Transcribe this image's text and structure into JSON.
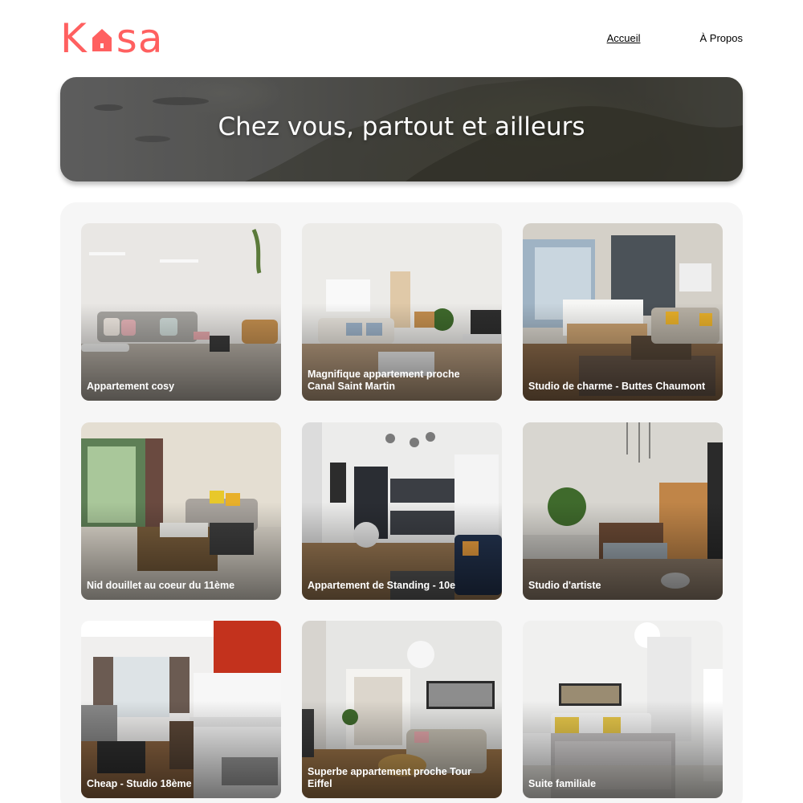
{
  "brand": {
    "logo_text_left": "K",
    "logo_text_right": "sa",
    "logo_icon": "house-icon",
    "accent": "#FF6060"
  },
  "nav": {
    "items": [
      {
        "label": "Accueil",
        "active": true
      },
      {
        "label": "À Propos",
        "active": false
      }
    ]
  },
  "banner": {
    "title": "Chez vous, partout et ailleurs"
  },
  "gallery": {
    "background": "#F6F6F6",
    "cards": [
      {
        "title": "Appartement cosy"
      },
      {
        "title": "Magnifique appartement proche Canal Saint Martin"
      },
      {
        "title": "Studio de charme - Buttes Chaumont"
      },
      {
        "title": "Nid douillet au coeur du 11ème"
      },
      {
        "title": "Appartement de Standing - 10e"
      },
      {
        "title": "Studio d'artiste"
      },
      {
        "title": "Cheap - Studio 18ème"
      },
      {
        "title": "Superbe appartement proche Tour Eiffel"
      },
      {
        "title": "Suite familiale"
      }
    ]
  }
}
